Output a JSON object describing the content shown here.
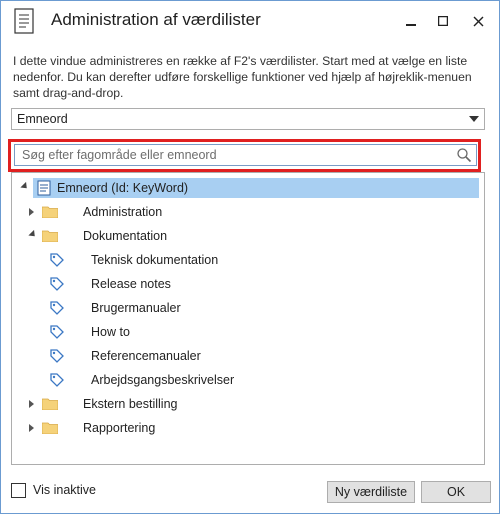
{
  "window": {
    "title": "Administration af værdilister",
    "minimize_label": "_",
    "maximize_label": "☐",
    "close_label": "✕"
  },
  "description": "I dette vindue administreres en række af F2's værdilister. Start med at vælge en liste nedenfor. Du kan derefter udføre forskellige funktioner ved hjælp af højreklik-menuen samt drag-and-drop.",
  "list_select": {
    "value": "Emneord"
  },
  "search": {
    "placeholder": "Søg efter fagområde eller emneord"
  },
  "tree": {
    "root": {
      "label": "Emneord (Id: KeyWord)",
      "icon": "document-icon"
    },
    "items": [
      {
        "label": "Administration",
        "type": "folder",
        "expanded": false
      },
      {
        "label": "Dokumentation",
        "type": "folder",
        "expanded": true,
        "children": [
          {
            "label": "Teknisk dokumentation",
            "icon": "tag-icon"
          },
          {
            "label": "Release notes",
            "icon": "tag-icon"
          },
          {
            "label": "Brugermanualer",
            "icon": "tag-icon"
          },
          {
            "label": "How to",
            "icon": "tag-icon"
          },
          {
            "label": "Referencemanualer",
            "icon": "tag-icon"
          },
          {
            "label": "Arbejdsgangsbeskrivelser",
            "icon": "tag-icon"
          }
        ]
      },
      {
        "label": "Ekstern bestilling",
        "type": "folder",
        "expanded": false
      },
      {
        "label": "Rapportering",
        "type": "folder",
        "expanded": false
      }
    ]
  },
  "footer": {
    "checkbox_label": "Vis inaktive",
    "checked": false,
    "new_list_button": "Ny værdiliste",
    "ok_button": "OK"
  },
  "colors": {
    "selection": "#a8cff2",
    "highlight_border": "#e02020",
    "folder": "#f5d27a",
    "tag": "#3b78c4"
  }
}
